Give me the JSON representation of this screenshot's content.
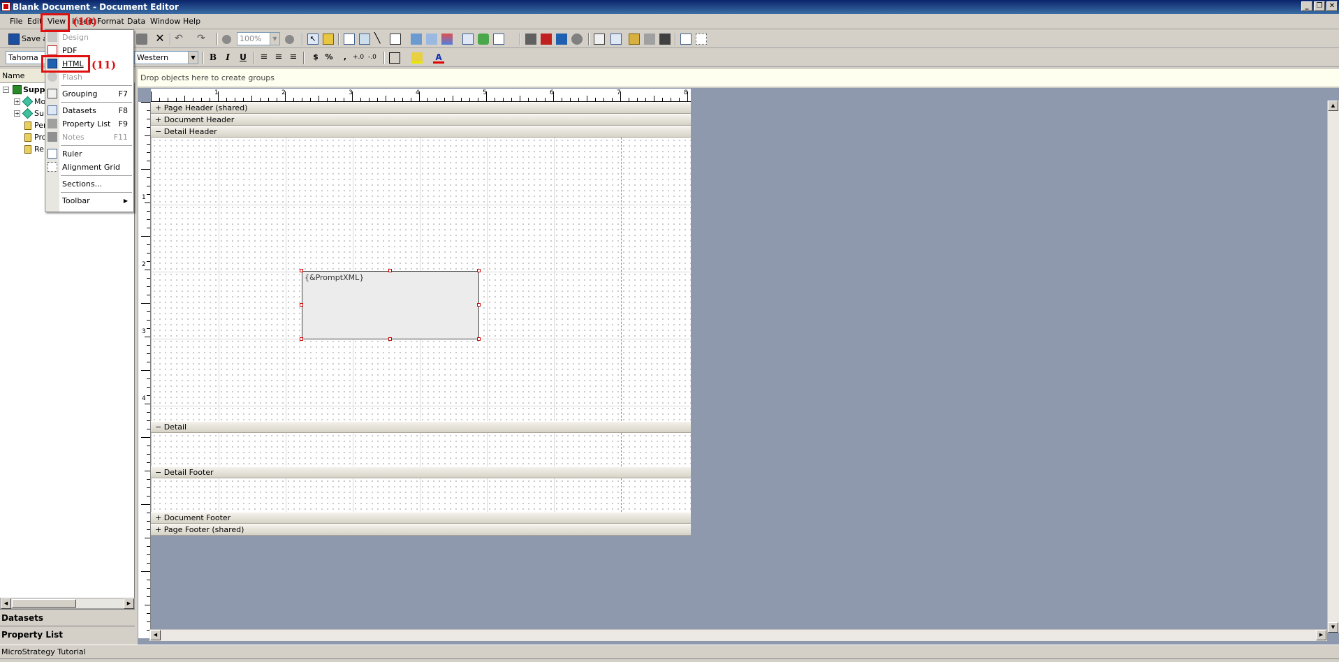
{
  "window": {
    "title": "Blank Document - Document Editor"
  },
  "menubar": [
    "File",
    "Edit",
    "View",
    "Insert",
    "Format",
    "Data",
    "Window",
    "Help"
  ],
  "toolbar": {
    "save_label": "Save a",
    "zoom_value": "100%",
    "font_value": "Tahoma",
    "charset_value": "Western",
    "currency_symbol": "$",
    "percent_symbol": "%",
    "comma_symbol": ","
  },
  "groupbar": {
    "text": "Drop objects here to create groups"
  },
  "left_panel": {
    "header": "Name",
    "tree": [
      {
        "label": "Suppl",
        "bold": true
      },
      {
        "label": "Mo"
      },
      {
        "label": "Sup"
      },
      {
        "label": "Per"
      },
      {
        "label": "Pro"
      },
      {
        "label": "Re"
      }
    ],
    "bottom_tabs": [
      "Datasets",
      "Property List"
    ]
  },
  "view_menu": {
    "items": [
      {
        "label": "Design",
        "shortcut": "",
        "disabled": true
      },
      {
        "label": "PDF",
        "shortcut": "",
        "disabled": false
      },
      {
        "label": "HTML",
        "shortcut": "",
        "disabled": false
      },
      {
        "label": "Flash",
        "shortcut": "",
        "disabled": true
      },
      {
        "label": "Grouping",
        "shortcut": "F7",
        "disabled": false
      },
      {
        "label": "Datasets",
        "shortcut": "F8",
        "disabled": false
      },
      {
        "label": "Property List",
        "shortcut": "F9",
        "disabled": false
      },
      {
        "label": "Notes",
        "shortcut": "F11",
        "disabled": true
      },
      {
        "label": "Ruler",
        "shortcut": "",
        "disabled": false
      },
      {
        "label": "Alignment Grid",
        "shortcut": "",
        "disabled": false
      },
      {
        "label": "Sections...",
        "shortcut": "",
        "disabled": false
      },
      {
        "label": "Toolbar",
        "shortcut": "",
        "disabled": false
      }
    ]
  },
  "annotations": {
    "view_label": "(10)",
    "html_label": "(11)"
  },
  "sections": {
    "page_header": "+ Page Header (shared)",
    "document_header": "+ Document Header",
    "detail_header": "− Detail Header",
    "detail": "− Detail",
    "detail_footer": "− Detail Footer",
    "document_footer": "+ Document Footer",
    "page_footer": "+ Page Footer (shared)"
  },
  "textfield": {
    "text": "{&PromptXML}"
  },
  "ruler": {
    "top": [
      "1",
      "2",
      "3",
      "4",
      "5",
      "6",
      "7",
      "8"
    ],
    "left": [
      "1",
      "2",
      "3",
      "4"
    ]
  },
  "status": {
    "text": "MicroStrategy Tutorial"
  },
  "colors": {
    "canvas_bg": "#8f99ad",
    "annotation": "#e01010",
    "title_bar": "#0a246a"
  }
}
